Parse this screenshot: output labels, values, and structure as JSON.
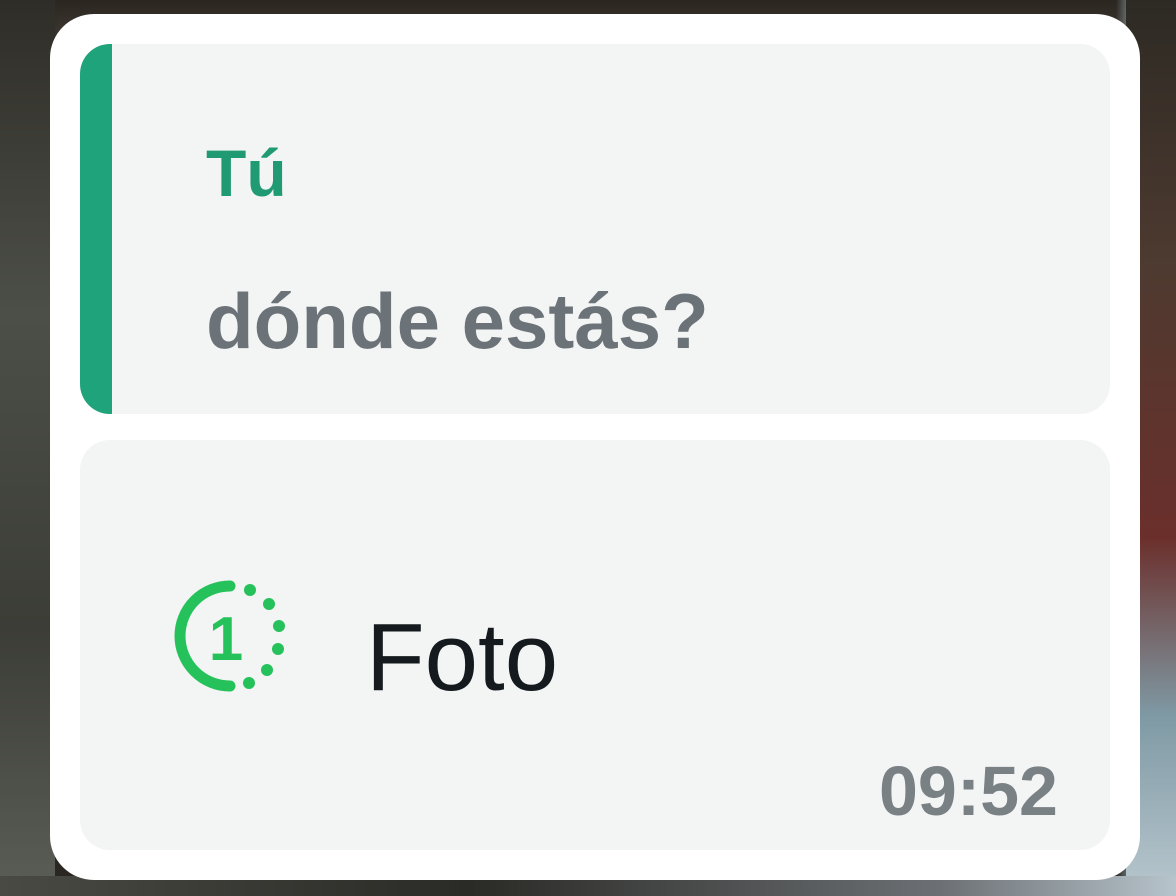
{
  "reply": {
    "author": "Tú",
    "text": "dónde estás?"
  },
  "message": {
    "icon": "view-once-icon",
    "icon_label": "1",
    "text": "Foto",
    "time": "09:52"
  },
  "colors": {
    "accent": "#1fa37a",
    "view_once_green": "#25c15a",
    "bubble": "#f3f4f4",
    "card": "#ffffff",
    "quote_text": "#6b7378",
    "timestamp": "#7a8185"
  }
}
